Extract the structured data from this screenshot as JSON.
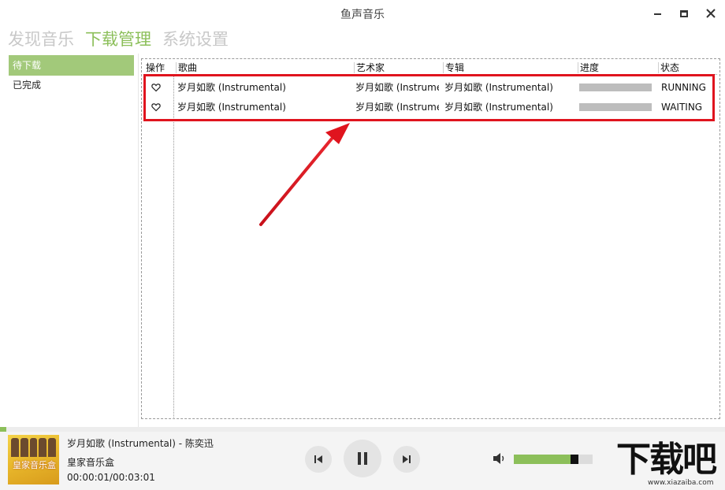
{
  "window": {
    "title": "鱼声音乐"
  },
  "main_nav": [
    {
      "label": "发现音乐",
      "active": false
    },
    {
      "label": "下载管理",
      "active": true
    },
    {
      "label": "系统设置",
      "active": false
    }
  ],
  "sidebar": {
    "items": [
      {
        "label": "待下载",
        "active": true
      },
      {
        "label": "已完成",
        "active": false
      }
    ]
  },
  "table": {
    "columns": [
      "操作",
      "歌曲",
      "艺术家",
      "专辑",
      "进度",
      "状态"
    ],
    "rows": [
      {
        "action_icon": "heart-icon",
        "song": "岁月如歌 (Instrumental)",
        "artist": "岁月如歌 (Instrumental)",
        "album": "岁月如歌 (Instrumental)",
        "progress": 0,
        "status": "RUNNING"
      },
      {
        "action_icon": "heart-icon",
        "song": "岁月如歌 (Instrumental)",
        "artist": "岁月如歌 (Instrumental)",
        "album": "岁月如歌 (Instrumental)",
        "progress": 0,
        "status": "WAITING"
      }
    ]
  },
  "player": {
    "track_title": "岁月如歌 (Instrumental) - 陈奕迅",
    "album": "皇家音乐盒",
    "time": "00:00:01/00:03:01",
    "cover_text": "皇家音乐盒",
    "playback_fraction": 0.006,
    "volume_fraction": 0.8,
    "state": "playing"
  },
  "watermark": {
    "text": "下载吧",
    "url": "www.xiazaiba.com"
  },
  "colors": {
    "accent": "#8cbf5a",
    "sidebar_active": "#a2c97a",
    "highlight": "#e0141e",
    "progress_track": "#bdbdbd"
  }
}
